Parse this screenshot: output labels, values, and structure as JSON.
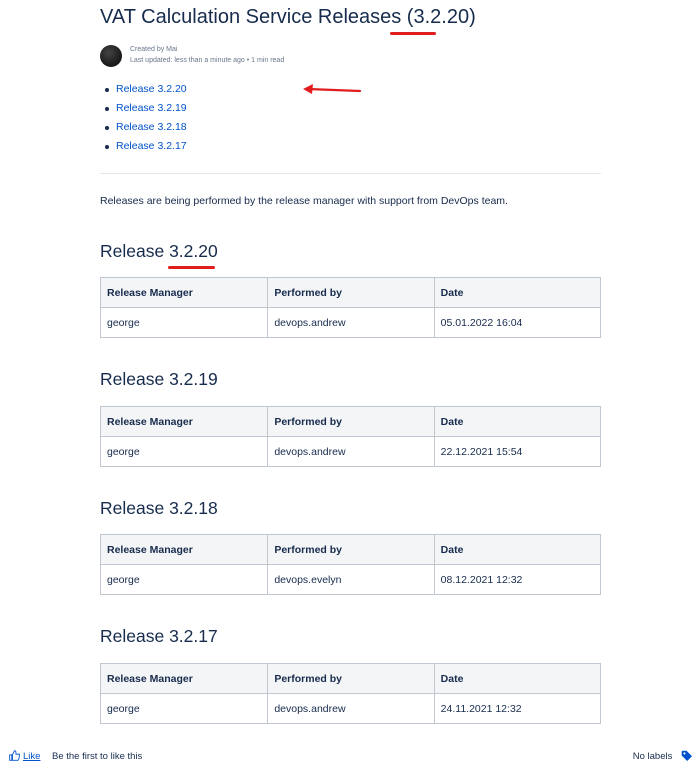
{
  "page": {
    "title_prefix": "VAT Calculation Service Releases (",
    "title_version": "3.2.20",
    "title_suffix": ")",
    "created_by": "Created by Mai",
    "last_updated": "Last updated: less than a minute ago •  1 min read",
    "intro": "Releases are being performed by the release manager with support from DevOps team."
  },
  "toc": [
    {
      "label": "Release 3.2.20"
    },
    {
      "label": "Release 3.2.19"
    },
    {
      "label": "Release 3.2.18"
    },
    {
      "label": "Release 3.2.17"
    }
  ],
  "table_headers": {
    "manager": "Release Manager",
    "performed_by": "Performed by",
    "date": "Date"
  },
  "releases": [
    {
      "heading_prefix": "Release ",
      "version": "3.2.20",
      "manager": "george",
      "performed_by": "devops.andrew",
      "date": "05.01.2022 16:04"
    },
    {
      "heading_prefix": "Release ",
      "version": "3.2.19",
      "manager": "george",
      "performed_by": "devops.andrew",
      "date": "22.12.2021 15:54"
    },
    {
      "heading_prefix": "Release ",
      "version": "3.2.18",
      "manager": "george",
      "performed_by": "devops.evelyn",
      "date": "08.12.2021 12:32"
    },
    {
      "heading_prefix": "Release ",
      "version": "3.2.17",
      "manager": "george",
      "performed_by": "devops.andrew",
      "date": "24.11.2021 12:32"
    }
  ],
  "footer": {
    "like_label": "Like",
    "like_text": "Be the first to like this",
    "labels_text": "No labels"
  },
  "colors": {
    "link": "#0052cc",
    "text": "#172b4d",
    "annotation": "#e11d1d"
  },
  "icons": {
    "like": "thumbs-up-icon",
    "labels": "tag-icon",
    "arrow": "red-arrow-annotation"
  }
}
